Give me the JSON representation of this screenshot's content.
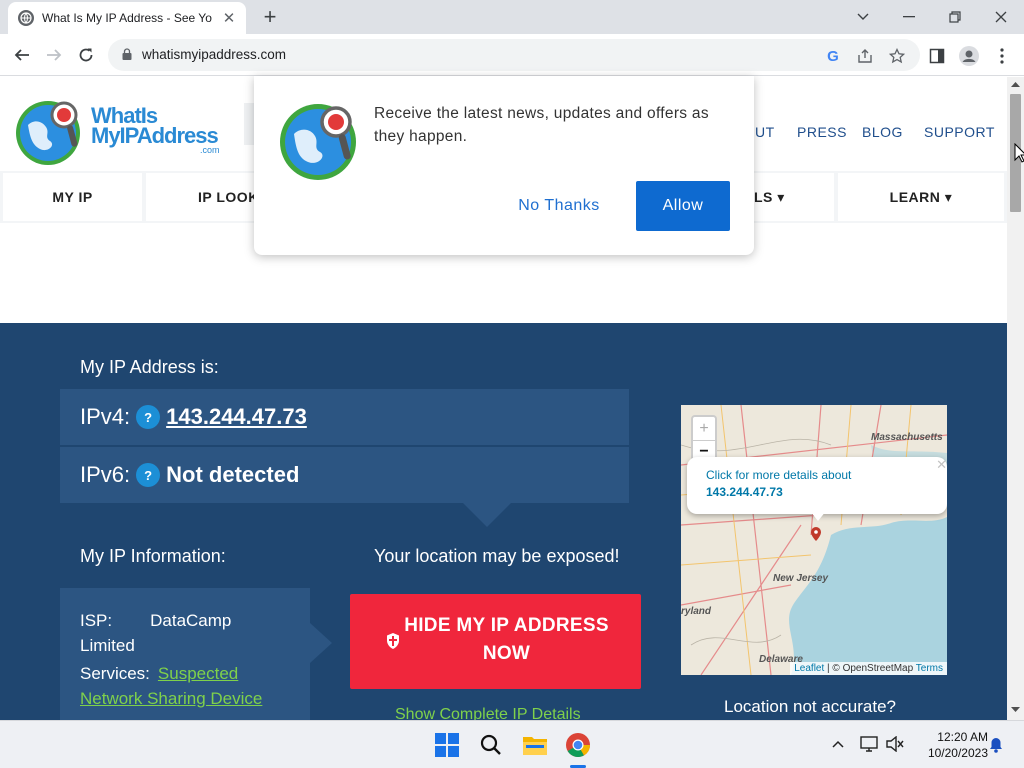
{
  "browser": {
    "tab_title": "What Is My IP Address - See Your",
    "url": "whatismyipaddress.com",
    "window_controls": [
      "chevron-down-icon",
      "minimize-icon",
      "restore-icon",
      "close-icon"
    ]
  },
  "site": {
    "logo": {
      "line1": "WhatIs",
      "line2": "MyIPAddress",
      "suffix": ".com"
    },
    "top_nav": [
      "UT",
      "PRESS",
      "BLOG",
      "SUPPORT"
    ],
    "main_nav": [
      "MY IP",
      "IP LOOK",
      "LS ▾",
      "LEARN ▾"
    ]
  },
  "popup": {
    "message": "Receive the latest news, updates and offers as they happen.",
    "no_thanks": "No Thanks",
    "allow": "Allow"
  },
  "hero": {
    "heading": "My IP Address is:",
    "ipv4_label": "IPv4:",
    "ipv4_value": "143.244.47.73",
    "ipv6_label": "IPv6:",
    "ipv6_value": "Not detected",
    "qmark": "?",
    "info_heading": "My IP Information:",
    "exposed": "Your location may be exposed!",
    "isp_label": "ISP:",
    "isp_value": "DataCamp",
    "isp_value_2": "Limited",
    "services_label": "Services:",
    "services_value_1": "Suspected",
    "services_value_2": "Network Sharing Device",
    "hide_button_line1": "HIDE MY IP ADDRESS",
    "hide_button_line2": "NOW",
    "show_details": "Show Complete IP Details",
    "location_not_accurate": "Location not accurate?"
  },
  "map": {
    "zoom_in": "+",
    "zoom_out": "−",
    "popup_text": "Click for more details about",
    "popup_ip": "143.244.47.73",
    "label_massachusetts": "Massachusetts",
    "label_new_jersey": "New Jersey",
    "label_maryland": "ryland",
    "label_delaware": "Delaware",
    "attribution_leaflet": "Leaflet",
    "attribution_sep": " | © OpenStreetMap ",
    "attribution_terms": "Terms"
  },
  "taskbar": {
    "time": "12:20 AM",
    "date": "10/20/2023"
  },
  "colors": {
    "hero_bg": "#1f4670",
    "ip_box_bg": "#2c5582",
    "hide_button": "#f0263c",
    "allow_button": "#0e6ad0",
    "link_green": "#7fd14b"
  }
}
